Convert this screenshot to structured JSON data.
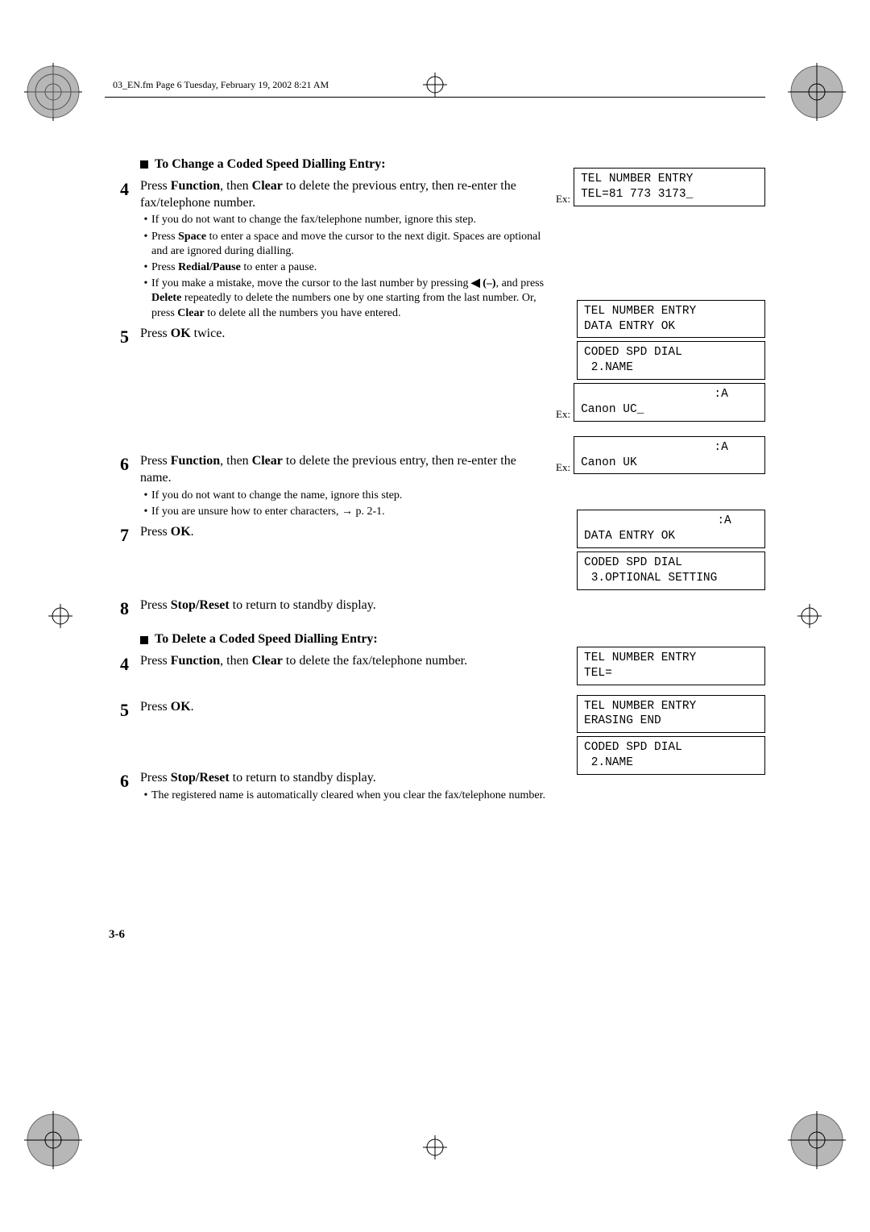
{
  "header": "03_EN.fm Page 6 Tuesday, February 19, 2002 8:21 AM",
  "section_change": "To Change a Coded Speed Dialling Entry:",
  "section_delete": "To Delete a Coded Speed Dialling Entry:",
  "steps": {
    "c4": {
      "main_pre": "Press ",
      "b1": "Function",
      "mid": ", then ",
      "b2": "Clear",
      "post": " to delete the previous entry, then re-enter the fax/telephone number.",
      "sub1": "If you do not want to change the fax/telephone number, ignore this step.",
      "sub2_pre": "Press ",
      "sub2_b": "Space",
      "sub2_post": " to enter a space and move the cursor to the next digit. Spaces are optional and are ignored during dialling.",
      "sub3_pre": "Press ",
      "sub3_b": "Redial/Pause",
      "sub3_post": " to enter a pause.",
      "sub4_pre": "If you make a mistake, move the cursor to the last number by pressing ",
      "sub4_sym": "◀ (–)",
      "sub4_mid": ", and press ",
      "sub4_b": "Delete",
      "sub4_post1": " repeatedly to delete the numbers one by one starting from the last number. Or, press ",
      "sub4_b2": "Clear",
      "sub4_post2": " to delete all the numbers you have entered."
    },
    "c5": {
      "pre": "Press ",
      "b": "OK",
      "post": " twice."
    },
    "c6": {
      "pre": "Press ",
      "b1": "Function",
      "mid": ", then ",
      "b2": "Clear",
      "post": " to delete the previous entry, then re-enter the name.",
      "sub1": "If you do not want to change the name, ignore this step.",
      "sub2_pre": "If you are unsure how to enter characters, ",
      "sub2_arrow": "→",
      "sub2_post": " p. 2-1."
    },
    "c7": {
      "pre": "Press ",
      "b": "OK",
      "post": "."
    },
    "c8": {
      "pre": "Press ",
      "b": "Stop/Reset",
      "post": " to return to standby display."
    },
    "d4": {
      "pre": "Press ",
      "b1": "Function",
      "mid": ", then ",
      "b2": "Clear",
      "post": " to delete the fax/telephone number."
    },
    "d5": {
      "pre": "Press ",
      "b": "OK",
      "post": "."
    },
    "d6": {
      "pre": "Press ",
      "b": "Stop/Reset",
      "post": " to return to standby display.",
      "sub": "The registered name is automatically cleared when you clear the fax/telephone number."
    }
  },
  "lcd": {
    "ex": "Ex:",
    "c4": "TEL NUMBER ENTRY\nTEL=81 773 3173_",
    "c5a": "TEL NUMBER ENTRY\nDATA ENTRY OK",
    "c5b": "CODED SPD DIAL\n 2.NAME",
    "c5c": "                   :A\nCanon UC_",
    "c6": "                   :A\nCanon UK",
    "c7a": "                   :A\nDATA ENTRY OK",
    "c7b": "CODED SPD DIAL\n 3.OPTIONAL SETTING",
    "d4": "TEL NUMBER ENTRY\nTEL=",
    "d5a": "TEL NUMBER ENTRY\nERASING END",
    "d5b": "CODED SPD DIAL\n 2.NAME"
  },
  "page_num": "3-6"
}
